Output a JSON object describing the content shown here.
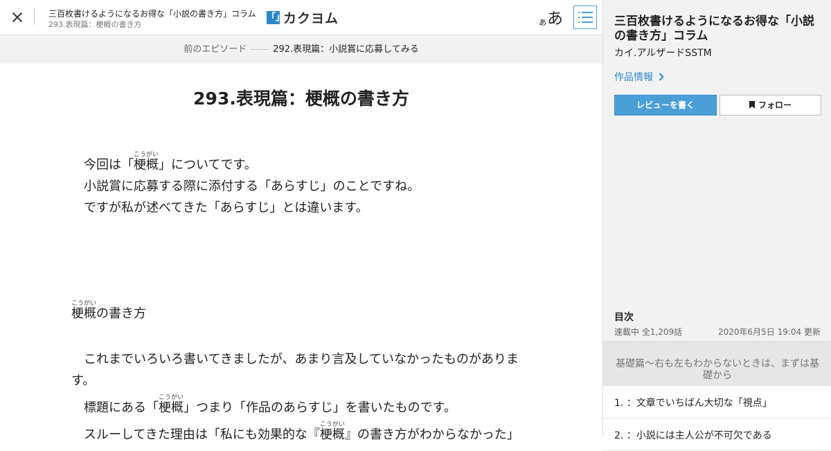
{
  "header": {
    "work_title": "三百枚書けるようになるお得な「小説の書き方」コラム",
    "episode_title": "293.表現篇：梗概の書き方",
    "logo_mark": "「」",
    "logo_text": "カクヨム",
    "font_small": "あ",
    "font_large": "あ"
  },
  "prev_episode": {
    "label": "前のエピソード",
    "title": "292.表現篇：小説賞に応募してみる"
  },
  "episode": {
    "heading": "293.表現篇：梗概の書き方",
    "p1_a": "今回は「",
    "ruby_word": "梗概",
    "ruby_reading": "こうがい",
    "p1_b": "」についてです。",
    "p2": "小説賞に応募する際に添付する「あらすじ」のことですね。",
    "p3": "ですが私が述べてきた「あらすじ」とは違います。",
    "subhead_b": "の書き方",
    "p4": "これまでいろいろ書いてきましたが、あまり言及していなかったものがあります。",
    "p5_a": "標題にある「",
    "p5_b": "」つまり「作品のあらすじ」を書いたものです。",
    "p6_a": "スルーしてきた理由は「私にも効果的な『",
    "p6_b": "』の書き方がわからなかった」"
  },
  "sidebar": {
    "title": "三百枚書けるようになるお得な「小説の書き方」コラム",
    "author": "カイ.アルザードSSTM",
    "info_link": "作品情報",
    "review_button": "レビューを書く",
    "follow_button": "フォロー",
    "toc_heading": "目次",
    "toc_status": "連載中 全1,209話",
    "toc_updated": "2020年6月5日 19:04 更新",
    "chapter": "基礎篇〜右も左もわからないときは、まずは基礎から",
    "items": [
      {
        "label": "1. ：文章でいちばん大切な「視点」"
      },
      {
        "label": "2. ：小説には主人公が不可欠である"
      }
    ]
  },
  "colors": {
    "accent": "#4a9fd6",
    "link": "#2e88c9",
    "sidebar_bg": "#f2f2f2"
  },
  "icons": [
    "close-icon",
    "toc-list-icon",
    "chevron-right-icon",
    "bookmark-plus-icon"
  ]
}
